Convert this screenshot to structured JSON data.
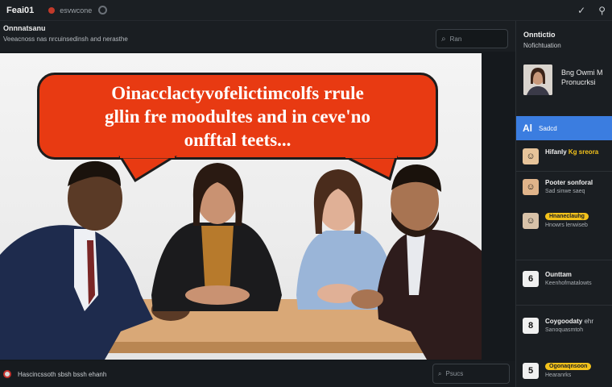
{
  "topbar": {
    "title": "Feai01",
    "subtitle": "esvwcone",
    "icons": [
      "check-icon",
      "pin-icon"
    ],
    "icon_glyphs": [
      "✓",
      "⚲"
    ]
  },
  "header": {
    "title": "Onnnatsanu",
    "subtitle": "Veeacnoss nas nrcuinsedinsh and nerasthe",
    "search_placeholder": "Ran"
  },
  "bubble": {
    "lines": [
      "Oinacclactyvofelictimcolfs rrule",
      "gllin fre moodultes and in ceve'no",
      "onfftal teets..."
    ]
  },
  "bottom": {
    "caption": "Hascincssoth sbsh bssh ehanh",
    "reply_placeholder": "Psucs"
  },
  "sidebar": {
    "heading": "Onntictio",
    "heading_sub": "Nofichtuation",
    "profile": {
      "line1": "Bng Owmi M",
      "line2": "Pronucrksi"
    },
    "active": {
      "icon": "Al",
      "label": "Sadcd"
    },
    "items": [
      {
        "title": "Hifanly",
        "highlight": "Kg sreora",
        "sub": ""
      },
      {
        "title": "Pooter sonforal",
        "highlight": "",
        "sub": "Sad sinwe saeq"
      },
      {
        "title": "",
        "highlight": "",
        "pill": "Hnaneclauhg",
        "sub": "Hnowrs lenwiseb"
      },
      {
        "title": "Ounttam",
        "highlight": "",
        "sub": "Keenhofmatalowts"
      },
      {
        "title": "Coygoodaty",
        "highlight": "",
        "sub": "ehr",
        "sub2": "Sanoquasmtoh"
      },
      {
        "title": "",
        "highlight": "",
        "pill": "Ogonaqnsoon",
        "sub": "Hearanrks"
      }
    ],
    "item_icons": [
      "number-6-icon",
      "number-8-icon",
      "number-5-icon"
    ],
    "item_icon_glyphs": [
      "6",
      "8",
      "5"
    ]
  },
  "colors": {
    "accent_blue": "#3b7de0",
    "bubble_red": "#e83a12",
    "highlight_yellow": "#f3c21b"
  }
}
